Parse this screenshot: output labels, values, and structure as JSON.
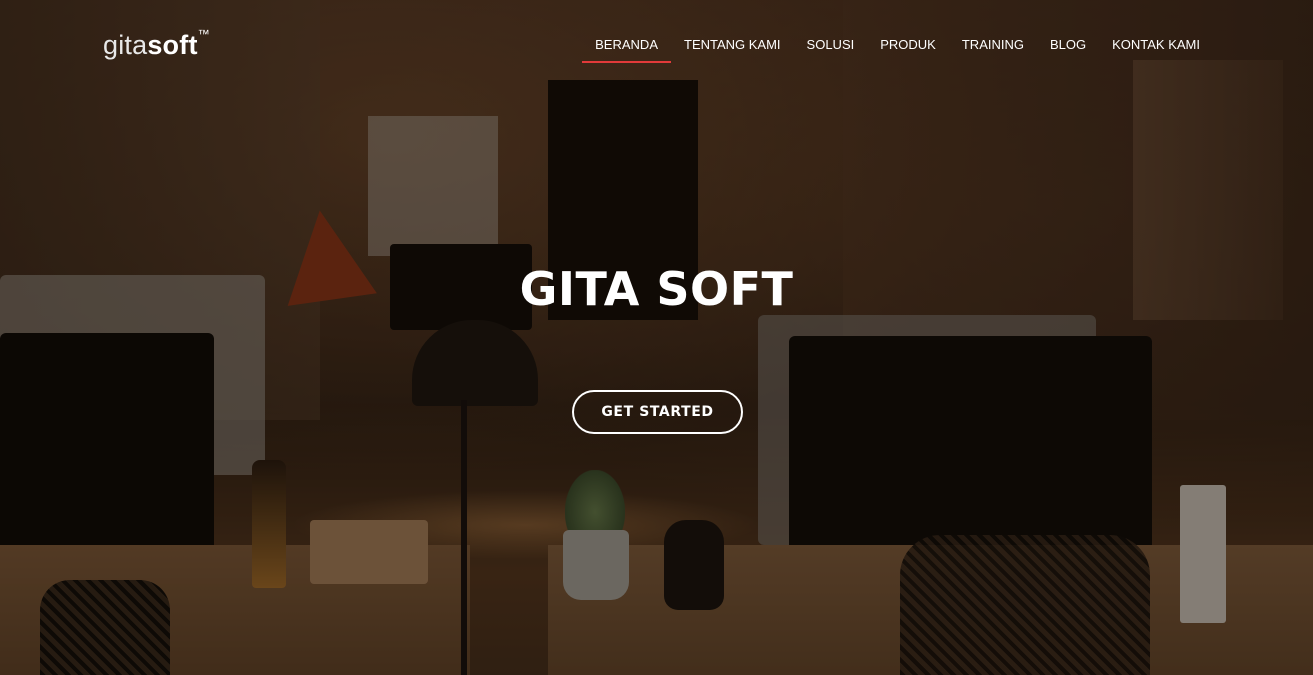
{
  "header": {
    "logo": {
      "part1": "gita",
      "part2": "soft",
      "trademark": "™"
    },
    "nav": [
      {
        "label": "BERANDA",
        "active": true
      },
      {
        "label": "TENTANG KAMI",
        "active": false
      },
      {
        "label": "SOLUSI",
        "active": false
      },
      {
        "label": "PRODUK",
        "active": false
      },
      {
        "label": "TRAINING",
        "active": false
      },
      {
        "label": "BLOG",
        "active": false
      },
      {
        "label": "KONTAK KAMI",
        "active": false
      }
    ]
  },
  "hero": {
    "title": "GITA SOFT",
    "cta_label": "GET STARTED"
  },
  "colors": {
    "accent": "#e23a3a",
    "text": "#ffffff"
  }
}
